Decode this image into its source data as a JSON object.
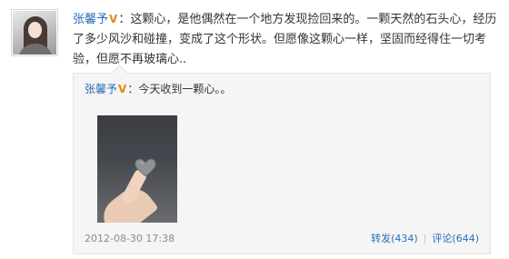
{
  "post": {
    "author": "张馨予",
    "verified_badge": "V",
    "separator": "：",
    "content": "这颗心，是他偶然在一个地方发现捡回来的。一颗天然的石头心，经历了多少风沙和碰撞，变成了这个形状。但愿像这颗心一样，坚固而经得住一切考验，但愿不再玻璃心.."
  },
  "repost": {
    "author": "张馨予",
    "verified_badge": "V",
    "separator": "：",
    "content": "今天收到一颗心。。",
    "timestamp": "2012-08-30 17:38",
    "forward_label": "转发(434)",
    "action_separator": "|",
    "comment_label": "评论(644)"
  }
}
